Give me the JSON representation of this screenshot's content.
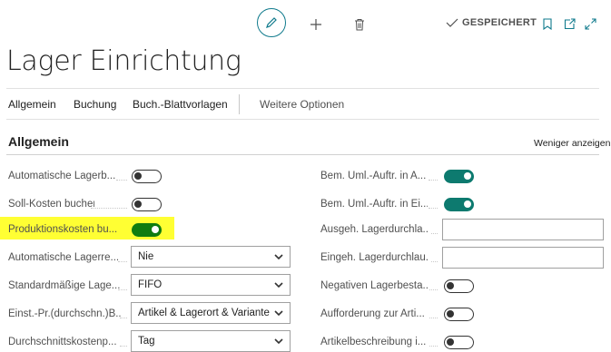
{
  "toolbar": {
    "saved_label": "GESPEICHERT"
  },
  "page": {
    "title": "Lager Einrichtung"
  },
  "nav": {
    "items": [
      "Allgemein",
      "Buchung",
      "Buch.-Blattvorlagen"
    ],
    "more": "Weitere Optionen"
  },
  "section": {
    "title": "Allgemein",
    "toggle_link": "Weniger anzeigen"
  },
  "left_fields": [
    {
      "label": "Automatische Lagerb...",
      "type": "toggle",
      "value": "off"
    },
    {
      "label": "Soll-Kosten buchen",
      "type": "toggle",
      "value": "off"
    },
    {
      "label": "Produktionskosten bu...",
      "type": "toggle",
      "value": "on"
    },
    {
      "label": "Automatische Lagerre...",
      "type": "select",
      "value": "Nie"
    },
    {
      "label": "Standardmäßige Lage...",
      "type": "select",
      "value": "FIFO"
    },
    {
      "label": "Einst.-Pr.(durchschn.)B...",
      "type": "select",
      "value": "Artikel & Lagerort & Variante"
    },
    {
      "label": "Durchschnittskostenp...",
      "type": "select",
      "value": "Tag"
    }
  ],
  "right_fields": [
    {
      "label": "Bem. Uml.-Auftr. in A...",
      "type": "toggle",
      "value": "on"
    },
    {
      "label": "Bem. Uml.-Auftr. in Ei...",
      "type": "toggle",
      "value": "on"
    },
    {
      "label": "Ausgeh. Lagerdurchla...",
      "type": "text",
      "value": ""
    },
    {
      "label": "Eingeh. Lagerdurchlau...",
      "type": "text",
      "value": ""
    },
    {
      "label": "Negativen Lagerbesta...",
      "type": "toggle",
      "value": "off"
    },
    {
      "label": "Aufforderung zur Arti...",
      "type": "toggle",
      "value": "off"
    },
    {
      "label": "Artikelbeschreibung i...",
      "type": "toggle",
      "value": "off"
    }
  ],
  "colors": {
    "accent": "#0f7a8c",
    "toggle_on": "#0d7a6f",
    "highlight": "#ffff33"
  }
}
